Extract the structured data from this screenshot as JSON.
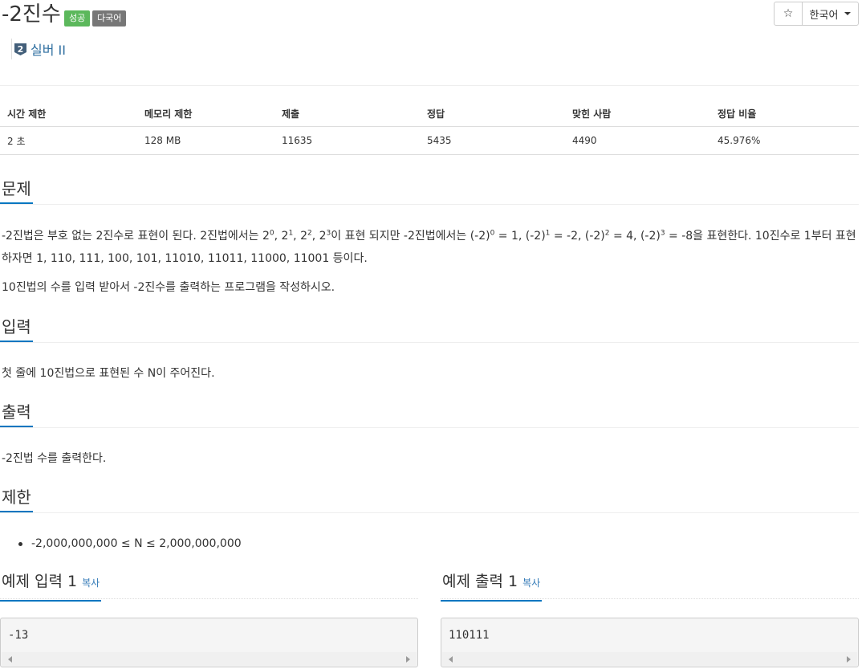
{
  "problem": {
    "title": "-2진수",
    "labels": {
      "success": "성공",
      "multilang": "다국어"
    },
    "tier": {
      "number": "2",
      "name": "실버 II"
    }
  },
  "toolbar": {
    "star_icon": "star-icon",
    "star_glyph": "☆",
    "language": "한국어"
  },
  "info_table": {
    "headers": [
      "시간 제한",
      "메모리 제한",
      "제출",
      "정답",
      "맞힌 사람",
      "정답 비율"
    ],
    "values": [
      "2 초",
      "128 MB",
      "11635",
      "5435",
      "4490",
      "45.976%"
    ]
  },
  "sections": {
    "description": {
      "title": "문제",
      "p1_a": "-2진법은 부호 없는 2진수로 표현이 된다. 2진법에서는 2",
      "p1_sup1": "0",
      "p1_b": ", 2",
      "p1_sup2": "1",
      "p1_c": ", 2",
      "p1_sup3": "2",
      "p1_d": ", 2",
      "p1_sup4": "3",
      "p1_e": "이 표현 되지만 -2진법에서는 (-2)",
      "p1_sup5": "0",
      "p1_f": " = 1, (-2)",
      "p1_sup6": "1",
      "p1_g": " = -2, (-2)",
      "p1_sup7": "2",
      "p1_h": " = 4, (-2)",
      "p1_sup8": "3",
      "p1_i": " = -8을 표현한다. 10진수로 1부터 표현",
      "p1_line2": "하자면 1, 110, 111, 100, 101, 11010, 11011, 11000, 11001 등이다.",
      "p2": "10진법의 수를 입력 받아서 -2진수를 출력하는 프로그램을 작성하시오."
    },
    "input": {
      "title": "입력",
      "text": "첫 줄에 10진법으로 표현된 수 N이 주어진다."
    },
    "output": {
      "title": "출력",
      "text": "-2진법 수를 출력한다."
    },
    "limit": {
      "title": "제한",
      "items": [
        "-2,000,000,000 ≤ N ≤ 2,000,000,000"
      ]
    }
  },
  "samples": {
    "input": {
      "title": "예제 입력 1",
      "copy": "복사",
      "content": "-13"
    },
    "output": {
      "title": "예제 출력 1",
      "copy": "복사",
      "content": "110111"
    }
  },
  "colors": {
    "accent": "#0076c0",
    "success": "#5cb85c",
    "gray_label": "#777777",
    "link": "#337ab7"
  }
}
